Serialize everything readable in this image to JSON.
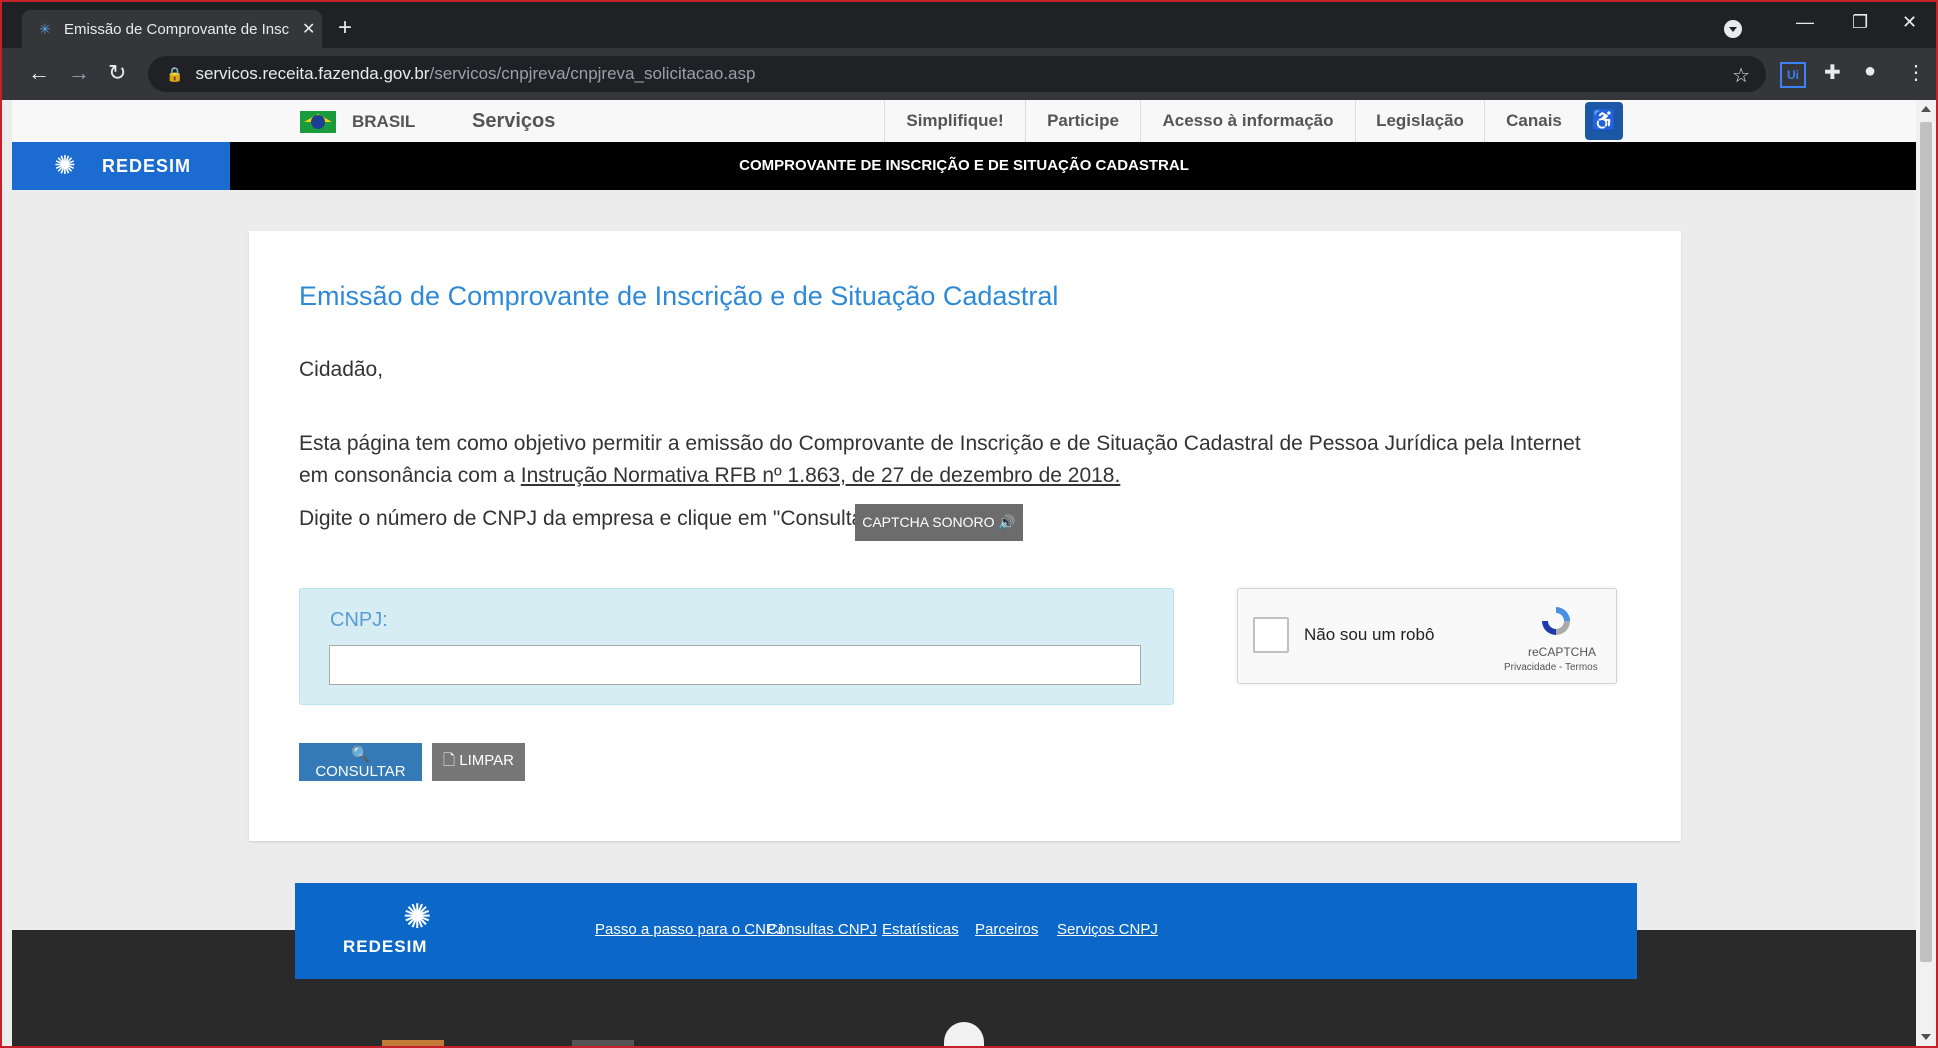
{
  "browser": {
    "tab_title": "Emissão de Comprovante de Insc",
    "tab_close": "✕",
    "new_tab": "+",
    "url_host": "servicos.receita.fazenda.gov.br",
    "url_path": "/servicos/cnpjreva/cnpjreva_solicitacao.asp",
    "icons": [
      "back-icon",
      "forward-icon",
      "reload-icon",
      "lock-icon",
      "star-icon",
      "uipath-icon",
      "extensions-icon",
      "profile-icon",
      "menu-icon",
      "minimize-icon",
      "restore-icon",
      "close-icon"
    ]
  },
  "govbar": {
    "brasil": "BRASIL",
    "servicos": "Serviços",
    "links": [
      "Simplifique!",
      "Participe",
      "Acesso à informação",
      "Legislação",
      "Canais"
    ]
  },
  "redesim": {
    "logo_text": "REDESIM",
    "title": "COMPROVANTE DE INSCRIÇÃO E DE SITUAÇÃO CADASTRAL"
  },
  "main": {
    "heading": "Emissão de Comprovante de Inscrição e de Situação Cadastral",
    "greeting": "Cidadão,",
    "desc_text": "Esta página tem como objetivo permitir a emissão do Comprovante de Inscrição e de Situação Cadastral de Pessoa Jurídica pela Internet em consonância com a ",
    "desc_link": "Instrução Normativa RFB nº 1.863, de 27 de dezembro de 2018.",
    "instruction": "Digite o número de CNPJ da empresa e clique em \"Consultar\".",
    "captcha_sonoro": "CAPTCHA SONORO 🔊",
    "cnpj_label": "CNPJ:",
    "cnpj_value": "",
    "recaptcha_label": "Não sou um robô",
    "recaptcha_brand": "reCAPTCHA",
    "recaptcha_terms": "Privacidade - Termos",
    "btn_consultar": "🔍 CONSULTAR",
    "btn_limpar": "🗋 LIMPAR"
  },
  "footer": {
    "logo_text": "REDESIM",
    "links": [
      "Passo a passo para o CNPJ",
      "Consultas CNPJ",
      "Estatísticas",
      "Parceiros",
      "Serviços CNPJ"
    ]
  },
  "colors": {
    "accent_blue": "#2e8ad8",
    "redesim_blue": "#1b6bd0",
    "consultar_btn": "#337ab7",
    "cnpj_box": "#d6eef3"
  }
}
